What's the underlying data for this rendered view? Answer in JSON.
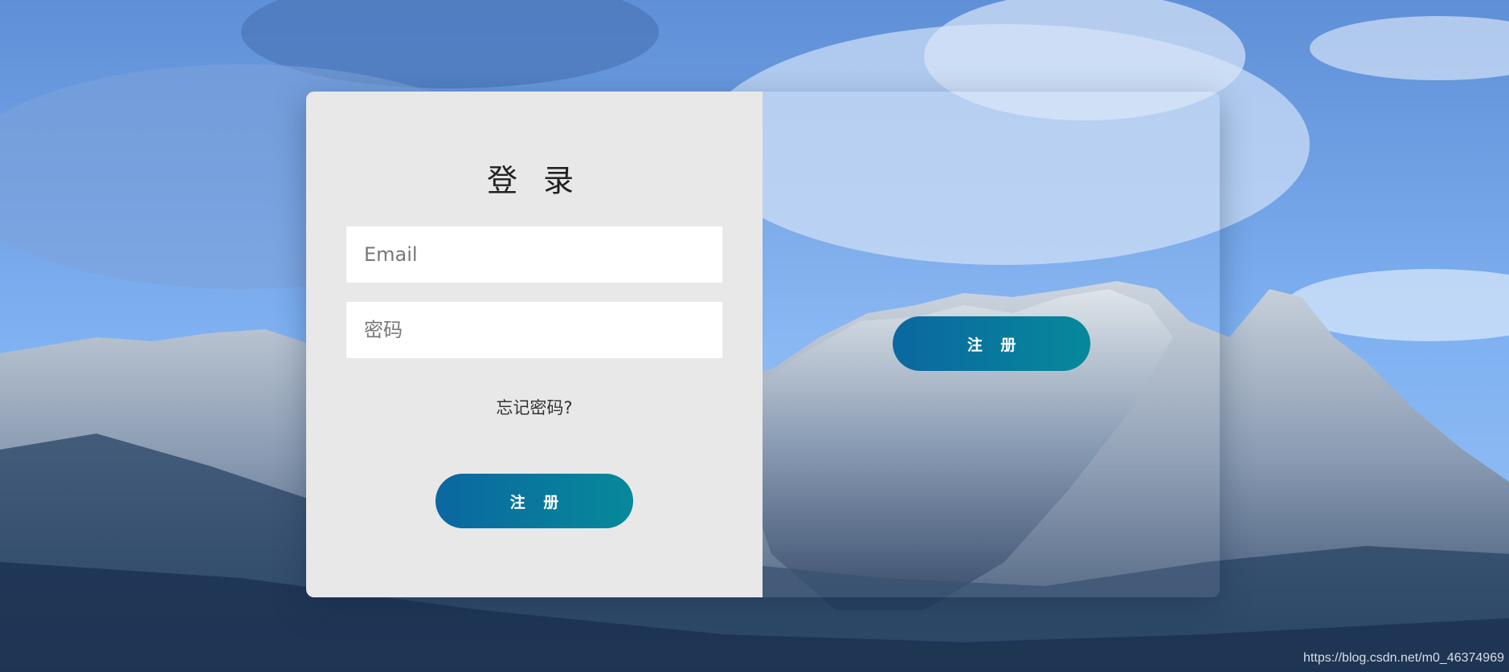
{
  "login": {
    "title": "登 录",
    "email_placeholder": "Email",
    "password_placeholder": "密码",
    "forgot_password": "忘记密码?",
    "submit_label": "注 册"
  },
  "overlay": {
    "register_label": "注 册"
  },
  "watermark": "https://blog.csdn.net/m0_46374969",
  "colors": {
    "button_gradient_start": "#0b67a0",
    "button_gradient_end": "#06899a",
    "form_background": "#e8e8e8",
    "sky": "#6aa9f0"
  },
  "background": {
    "scene": "mountain-landscape"
  }
}
